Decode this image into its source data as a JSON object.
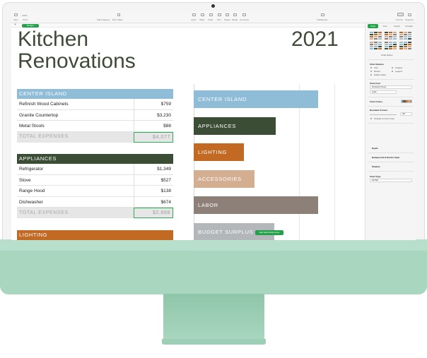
{
  "toolbar": {
    "view_label": "View",
    "zoom_value": "100%",
    "zoom_label": "Zoom",
    "add_category_label": "Add Category",
    "pivot_table_label": "Pivot Table",
    "insert_label": "Insert",
    "table_label": "Table",
    "chart_label": "Chart",
    "text_label": "Text",
    "shape_label": "Shape",
    "media_label": "Media",
    "comment_label": "Comment",
    "collaborate_label": "Collaborate",
    "format_label": "Format",
    "organize_label": "Organize"
  },
  "sheet_tab": "Budget",
  "document": {
    "title_line1": "Kitchen",
    "title_line2": "Renovations",
    "year": "2021"
  },
  "tables": [
    {
      "header": "CENTER ISLAND",
      "color": "#8fbcd6",
      "rows": [
        {
          "label": "Refinish Wood Cabinets",
          "value": "$759"
        },
        {
          "label": "Granite Countertop",
          "value": "$3,230"
        },
        {
          "label": "Metal Stools",
          "value": "$88"
        }
      ],
      "total_label": "TOTAL EXPENSES",
      "total_value": "$4,077"
    },
    {
      "header": "APPLIANCES",
      "color": "#3b4d34",
      "rows": [
        {
          "label": "Refrigerator",
          "value": "$1,349"
        },
        {
          "label": "Stove",
          "value": "$527"
        },
        {
          "label": "Range Hood",
          "value": "$138"
        },
        {
          "label": "Dishwasher",
          "value": "$674"
        }
      ],
      "total_label": "TOTAL EXPENSES",
      "total_value": "$2,688"
    },
    {
      "header": "LIGHTING",
      "color": "#c26a24"
    }
  ],
  "chart_data": {
    "type": "bar",
    "orientation": "horizontal",
    "categories": [
      "CENTER ISLAND",
      "APPLIANCES",
      "LIGHTING",
      "ACCESSORIES",
      "LABOR",
      "BUDGET SURPLUS"
    ],
    "values": [
      4077,
      2688,
      1640,
      1990,
      4070,
      2640
    ],
    "colors": [
      "#8fbcd6",
      "#3b4d34",
      "#c26a24",
      "#d3ae91",
      "#8d8079",
      "#b3b7ba"
    ],
    "xlim": [
      0,
      5000
    ],
    "grid": true,
    "legend": "none"
  },
  "chart_edit_button": "Edit Data References",
  "inspector": {
    "tabs": [
      "Chart",
      "Axis",
      "Series",
      "Arrange"
    ],
    "chart_styles_label": "Chart Styles",
    "chart_options_label": "Chart Options",
    "options": [
      "Title",
      "Caption",
      "Border",
      "Legend",
      "Hidden Data"
    ],
    "chart_font_label": "Chart Font",
    "font_value": "Helvetica Neue",
    "weight_value": "Light",
    "chart_colors_label": "Chart Colors",
    "rounded_corners_label": "Rounded Corners",
    "rounded_value": "0%",
    "outside_corners_label": "Outside Corners Only",
    "depth_label": "Depth",
    "background_label": "Background & Border Style",
    "shadow_label": "Shadow",
    "chart_type_label": "Chart Type",
    "chart_type_value": "2D Bar"
  }
}
